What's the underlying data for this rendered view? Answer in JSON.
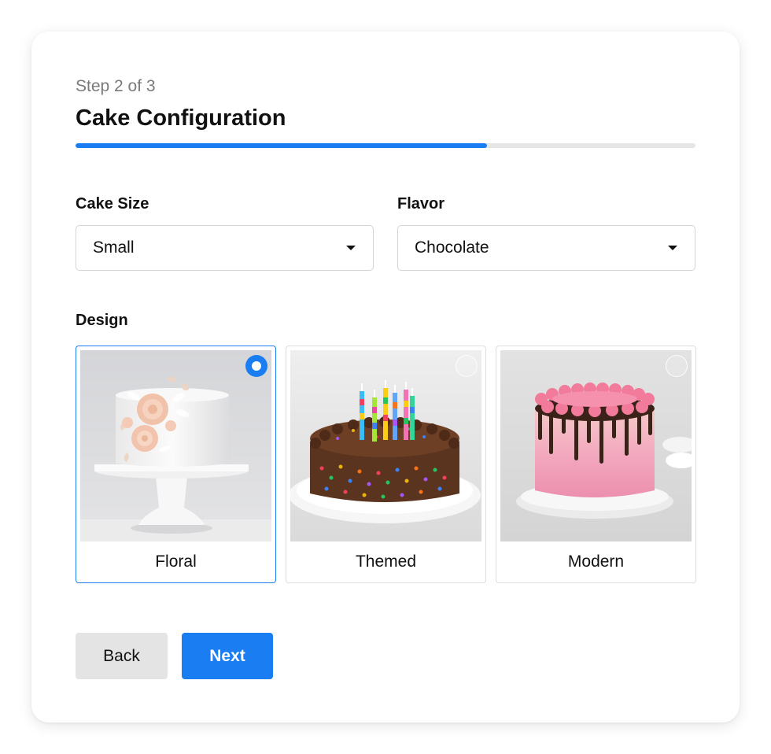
{
  "wizard": {
    "step_text": "Step 2 of 3",
    "title": "Cake Configuration",
    "progress_percent": 66.4
  },
  "size": {
    "label": "Cake Size",
    "selected": "Small"
  },
  "flavor": {
    "label": "Flavor",
    "selected": "Chocolate"
  },
  "design": {
    "label": "Design",
    "options": [
      {
        "caption": "Floral",
        "selected": true
      },
      {
        "caption": "Themed",
        "selected": false
      },
      {
        "caption": "Modern",
        "selected": false
      }
    ]
  },
  "buttons": {
    "back": "Back",
    "next": "Next"
  },
  "colors": {
    "accent": "#1a7ef2",
    "secondary_button": "#e4e4e4"
  }
}
